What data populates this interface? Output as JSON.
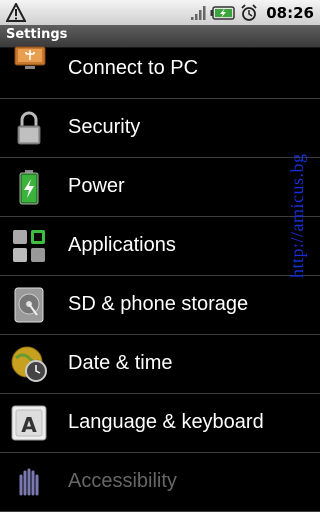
{
  "status_bar": {
    "time": "08:26",
    "icons": [
      "warning-icon",
      "signal-icon",
      "battery-charging-icon",
      "alarm-icon"
    ]
  },
  "title": "Settings",
  "items": [
    {
      "label": "Connect to PC",
      "icon": "usb-monitor-icon"
    },
    {
      "label": "Security",
      "icon": "lock-icon"
    },
    {
      "label": "Power",
      "icon": "battery-icon"
    },
    {
      "label": "Applications",
      "icon": "applications-icon"
    },
    {
      "label": "SD & phone storage",
      "icon": "storage-icon"
    },
    {
      "label": "Date & time",
      "icon": "globe-clock-icon"
    },
    {
      "label": "Language & keyboard",
      "icon": "keyboard-key-icon"
    },
    {
      "label": "Accessibility",
      "icon": "accessibility-hand-icon"
    }
  ],
  "watermark": "http://amicus.bg"
}
